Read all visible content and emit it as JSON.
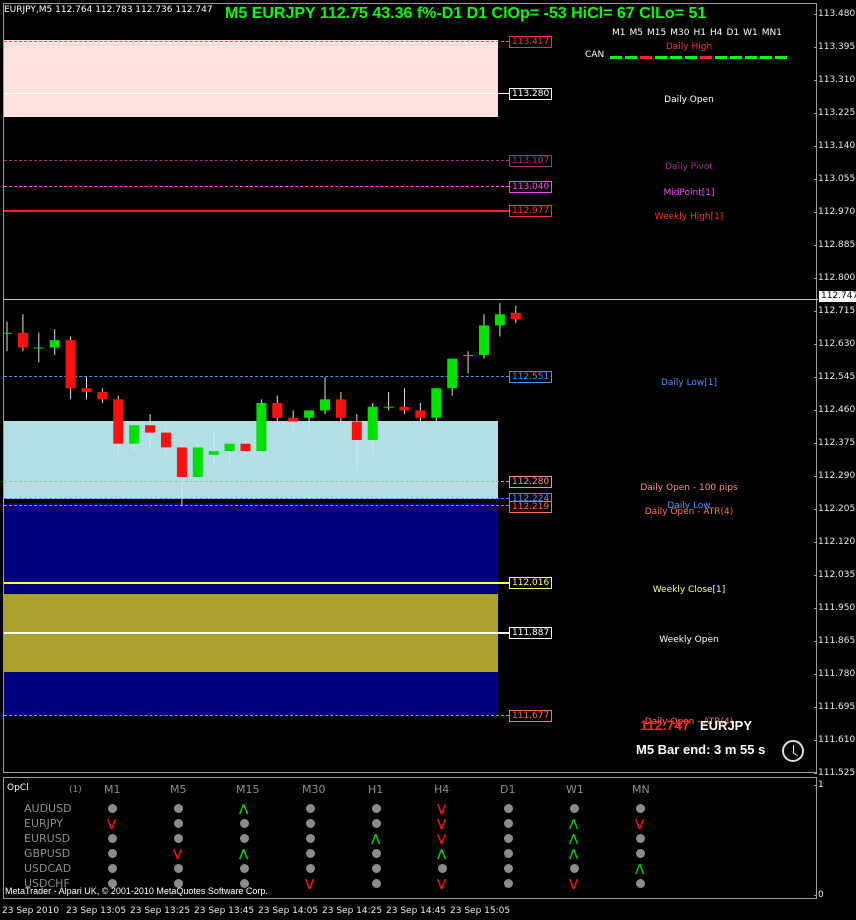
{
  "header": {
    "symbol_info": "EURJPY,M5  112.764 112.783 112.736 112.747",
    "title": "M5 EURJPY 112.75 43.36 f%-D1 D1 ClOp= -53 HiCl= 67 ClLo= 51"
  },
  "timeframes": [
    "M1",
    "M5",
    "M15",
    "M30",
    "H1",
    "H4",
    "D1",
    "W1",
    "MN1"
  ],
  "can_label": "CAN",
  "can_colors": [
    "#00ff00",
    "#00ff00",
    "#ff2020",
    "#00ff00",
    "#00ff00",
    "#00ff00",
    "#ff2020",
    "#00ff00",
    "#00ff00",
    "#00ff00",
    "#00ff00",
    "#00ff00"
  ],
  "price_axis": [
    "113.480",
    "113.395",
    "113.310",
    "113.225",
    "113.140",
    "113.055",
    "112.970",
    "112.885",
    "112.800",
    "112.715",
    "112.630",
    "112.545",
    "112.460",
    "112.375",
    "112.290",
    "112.205",
    "112.120",
    "112.035",
    "111.950",
    "111.865",
    "111.780",
    "111.695",
    "111.610",
    "111.525"
  ],
  "levels": [
    {
      "price": "113.417",
      "label": "Daily High",
      "color": "#ff3030"
    },
    {
      "price": "113.280",
      "label": "Daily Open",
      "color": "#ffffff"
    },
    {
      "price": "113.107",
      "label": "Daily Pivot",
      "color": "#a0308f"
    },
    {
      "price": "113.040",
      "label": "MidPoint[1]",
      "color": "#ff40ff"
    },
    {
      "price": "112.977",
      "label": "Weekly High[1]",
      "color": "#ff3030"
    },
    {
      "price": "112.551",
      "label": "Daily Low[1]",
      "color": "#4a90ff"
    },
    {
      "price": "112.280",
      "label": "Daily Open - 100 pips",
      "color": "#ff9090"
    },
    {
      "price": "112.224",
      "label": "Daily Low",
      "color": "#4a90ff"
    },
    {
      "price": "112.219",
      "label": "Daily Open - ATR(4)",
      "color": "#ff7040"
    },
    {
      "price": "112.016",
      "label": "Weekly Close[1]",
      "color": "#ffff60"
    },
    {
      "price": "111.887",
      "label": "Weekly Open",
      "color": "#ffffff"
    },
    {
      "price": "111.677",
      "label": "Daily Open - ATR(4)",
      "color": "#ff7040"
    }
  ],
  "current_price_tag": "112.747",
  "bottom_info": {
    "price": "112.747",
    "symbol": "EURJPY",
    "bar_end": "M5 Bar end: 3 m 55 s"
  },
  "chart_data": {
    "type": "candlestick",
    "symbol": "EURJPY",
    "timeframe": "M5",
    "ylim": [
      111.525,
      113.48
    ],
    "candles": [
      {
        "o": 112.71,
        "h": 112.74,
        "l": 112.66,
        "c": 112.71
      },
      {
        "o": 112.71,
        "h": 112.76,
        "l": 112.66,
        "c": 112.67
      },
      {
        "o": 112.67,
        "h": 112.71,
        "l": 112.63,
        "c": 112.67
      },
      {
        "o": 112.67,
        "h": 112.72,
        "l": 112.65,
        "c": 112.69
      },
      {
        "o": 112.69,
        "h": 112.7,
        "l": 112.53,
        "c": 112.56
      },
      {
        "o": 112.56,
        "h": 112.59,
        "l": 112.53,
        "c": 112.55
      },
      {
        "o": 112.55,
        "h": 112.56,
        "l": 112.52,
        "c": 112.53
      },
      {
        "o": 112.53,
        "h": 112.54,
        "l": 112.38,
        "c": 112.41
      },
      {
        "o": 112.41,
        "h": 112.46,
        "l": 112.39,
        "c": 112.46
      },
      {
        "o": 112.46,
        "h": 112.49,
        "l": 112.4,
        "c": 112.44
      },
      {
        "o": 112.44,
        "h": 112.46,
        "l": 112.38,
        "c": 112.4
      },
      {
        "o": 112.4,
        "h": 112.41,
        "l": 112.24,
        "c": 112.32
      },
      {
        "o": 112.32,
        "h": 112.41,
        "l": 112.31,
        "c": 112.4
      },
      {
        "o": 112.38,
        "h": 112.44,
        "l": 112.35,
        "c": 112.39
      },
      {
        "o": 112.39,
        "h": 112.41,
        "l": 112.35,
        "c": 112.41
      },
      {
        "o": 112.41,
        "h": 112.42,
        "l": 112.38,
        "c": 112.39
      },
      {
        "o": 112.39,
        "h": 112.53,
        "l": 112.38,
        "c": 112.52
      },
      {
        "o": 112.52,
        "h": 112.54,
        "l": 112.46,
        "c": 112.48
      },
      {
        "o": 112.48,
        "h": 112.5,
        "l": 112.44,
        "c": 112.47
      },
      {
        "o": 112.48,
        "h": 112.5,
        "l": 112.45,
        "c": 112.5
      },
      {
        "o": 112.5,
        "h": 112.59,
        "l": 112.49,
        "c": 112.53
      },
      {
        "o": 112.53,
        "h": 112.55,
        "l": 112.47,
        "c": 112.48
      },
      {
        "o": 112.47,
        "h": 112.49,
        "l": 112.34,
        "c": 112.42
      },
      {
        "o": 112.42,
        "h": 112.52,
        "l": 112.38,
        "c": 112.51
      },
      {
        "o": 112.51,
        "h": 112.55,
        "l": 112.5,
        "c": 112.51
      },
      {
        "o": 112.51,
        "h": 112.56,
        "l": 112.49,
        "c": 112.5
      },
      {
        "o": 112.5,
        "h": 112.52,
        "l": 112.47,
        "c": 112.48
      },
      {
        "o": 112.48,
        "h": 112.56,
        "l": 112.47,
        "c": 112.56
      },
      {
        "o": 112.56,
        "h": 112.64,
        "l": 112.54,
        "c": 112.64
      },
      {
        "o": 112.65,
        "h": 112.66,
        "l": 112.6,
        "c": 112.65
      },
      {
        "o": 112.65,
        "h": 112.76,
        "l": 112.64,
        "c": 112.73
      },
      {
        "o": 112.73,
        "h": 112.79,
        "l": 112.7,
        "c": 112.76
      },
      {
        "o": 112.764,
        "h": 112.783,
        "l": 112.736,
        "c": 112.747
      }
    ]
  },
  "subwindow": {
    "title": "OpCl",
    "param": "(1)",
    "headers": [
      "M1",
      "M5",
      "M15",
      "M30",
      "H1",
      "H4",
      "D1",
      "W1",
      "MN"
    ],
    "symbols": [
      "AUDUSD",
      "EURJPY",
      "EURUSD",
      "GBPUSD",
      "USDCAD",
      "USDCHF"
    ],
    "signals": [
      [
        "n",
        "n",
        "u",
        "n",
        "n",
        "d",
        "n",
        "n",
        "n"
      ],
      [
        "d",
        "n",
        "n",
        "n",
        "n",
        "d",
        "n",
        "u",
        "d"
      ],
      [
        "n",
        "n",
        "n",
        "n",
        "u",
        "d",
        "n",
        "u",
        "n"
      ],
      [
        "n",
        "d",
        "u",
        "n",
        "n",
        "u",
        "n",
        "u",
        "n"
      ],
      [
        "n",
        "n",
        "n",
        "n",
        "n",
        "n",
        "n",
        "n",
        "u"
      ],
      [
        "n",
        "n",
        "n",
        "d",
        "n",
        "d",
        "n",
        "d",
        "n"
      ]
    ],
    "axis": [
      "1",
      "0"
    ]
  },
  "copyright": "MetaTrader - Alpari UK, © 2001-2010 MetaQuotes Software Corp.",
  "time_axis": [
    "23 Sep 2010",
    "23 Sep 13:05",
    "23 Sep 13:25",
    "23 Sep 13:45",
    "23 Sep 14:05",
    "23 Sep 14:25",
    "23 Sep 14:45",
    "23 Sep 15:05"
  ]
}
